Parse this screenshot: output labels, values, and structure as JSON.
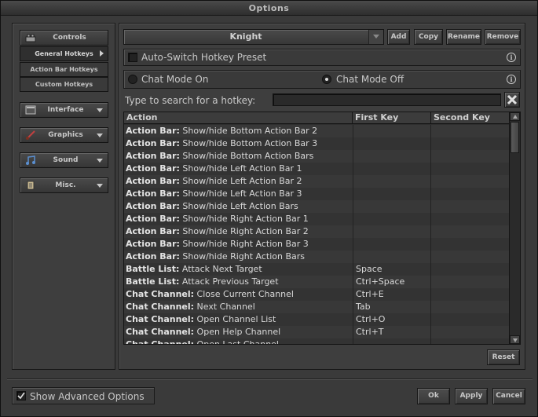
{
  "window": {
    "title": "Options"
  },
  "sidebar": {
    "controls_label": "Controls",
    "sub_items": [
      "General Hotkeys",
      "Action Bar Hotkeys",
      "Custom Hotkeys"
    ],
    "active_sub": "General Hotkeys",
    "interface_label": "Interface",
    "graphics_label": "Graphics",
    "sound_label": "Sound",
    "misc_label": "Misc."
  },
  "preset": {
    "selected": "Knight",
    "add_label": "Add",
    "copy_label": "Copy",
    "rename_label": "Rename",
    "remove_label": "Remove"
  },
  "autoswitch": {
    "label": "Auto-Switch Hotkey Preset",
    "checked": false
  },
  "chat_mode": {
    "on_label": "Chat Mode On",
    "off_label": "Chat Mode Off",
    "selected": "off"
  },
  "search": {
    "label": "Type to search for a hotkey:",
    "value": "",
    "clear_icon": "close-icon"
  },
  "table": {
    "columns": [
      "Action",
      "First Key",
      "Second Key"
    ],
    "rows": [
      {
        "category": "Action Bar:",
        "action": "Show/hide Bottom Action Bar 2",
        "first": "",
        "second": ""
      },
      {
        "category": "Action Bar:",
        "action": "Show/hide Bottom Action Bar 3",
        "first": "",
        "second": ""
      },
      {
        "category": "Action Bar:",
        "action": "Show/hide Bottom Action Bars",
        "first": "",
        "second": ""
      },
      {
        "category": "Action Bar:",
        "action": "Show/hide Left Action Bar 1",
        "first": "",
        "second": ""
      },
      {
        "category": "Action Bar:",
        "action": "Show/hide Left Action Bar 2",
        "first": "",
        "second": ""
      },
      {
        "category": "Action Bar:",
        "action": "Show/hide Left Action Bar 3",
        "first": "",
        "second": ""
      },
      {
        "category": "Action Bar:",
        "action": "Show/hide Left Action Bars",
        "first": "",
        "second": ""
      },
      {
        "category": "Action Bar:",
        "action": "Show/hide Right Action Bar 1",
        "first": "",
        "second": ""
      },
      {
        "category": "Action Bar:",
        "action": "Show/hide Right Action Bar 2",
        "first": "",
        "second": ""
      },
      {
        "category": "Action Bar:",
        "action": "Show/hide Right Action Bar 3",
        "first": "",
        "second": ""
      },
      {
        "category": "Action Bar:",
        "action": "Show/hide Right Action Bars",
        "first": "",
        "second": ""
      },
      {
        "category": "Battle List:",
        "action": "Attack Next Target",
        "first": "Space",
        "second": ""
      },
      {
        "category": "Battle List:",
        "action": "Attack Previous Target",
        "first": "Ctrl+Space",
        "second": ""
      },
      {
        "category": "Chat Channel:",
        "action": "Close Current Channel",
        "first": "Ctrl+E",
        "second": ""
      },
      {
        "category": "Chat Channel:",
        "action": "Next Channel",
        "first": "Tab",
        "second": ""
      },
      {
        "category": "Chat Channel:",
        "action": "Open Channel List",
        "first": "Ctrl+O",
        "second": ""
      },
      {
        "category": "Chat Channel:",
        "action": "Open Help Channel",
        "first": "Ctrl+T",
        "second": ""
      },
      {
        "category": "Chat Channel:",
        "action": "Open Last Channel",
        "first": "",
        "second": ""
      }
    ]
  },
  "reset_label": "Reset",
  "advanced": {
    "label": "Show Advanced Options",
    "checked": true
  },
  "footer": {
    "ok_label": "Ok",
    "apply_label": "Apply",
    "cancel_label": "Cancel"
  }
}
